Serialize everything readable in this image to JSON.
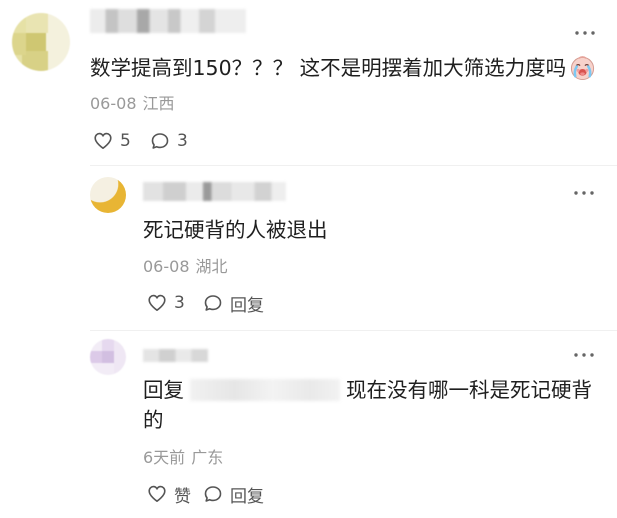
{
  "colors": {
    "text": "#1f1f1f",
    "meta": "#999999",
    "action": "#555555",
    "divider": "#f0f0f0"
  },
  "icons": {
    "more": "more-options-icon",
    "like": "heart-icon",
    "comment": "comment-bubble-icon",
    "emoji": "crying-face-emoji-icon"
  },
  "main_comment": {
    "text": "数学提高到150？？？ 这不是明摆着加大筛选力度吗",
    "time": "06-08",
    "location": "江西",
    "like_count": "5",
    "reply_count": "3"
  },
  "replies": [
    {
      "text": "死记硬背的人被退出",
      "time": "06-08",
      "location": "湖北",
      "like_label": "3",
      "reply_label": "回复"
    },
    {
      "reply_prefix": "回复",
      "text": "现在没有哪一科是死记硬背的",
      "time": "6天前",
      "location": "广东",
      "like_label": "赞",
      "reply_label": "回复"
    }
  ]
}
